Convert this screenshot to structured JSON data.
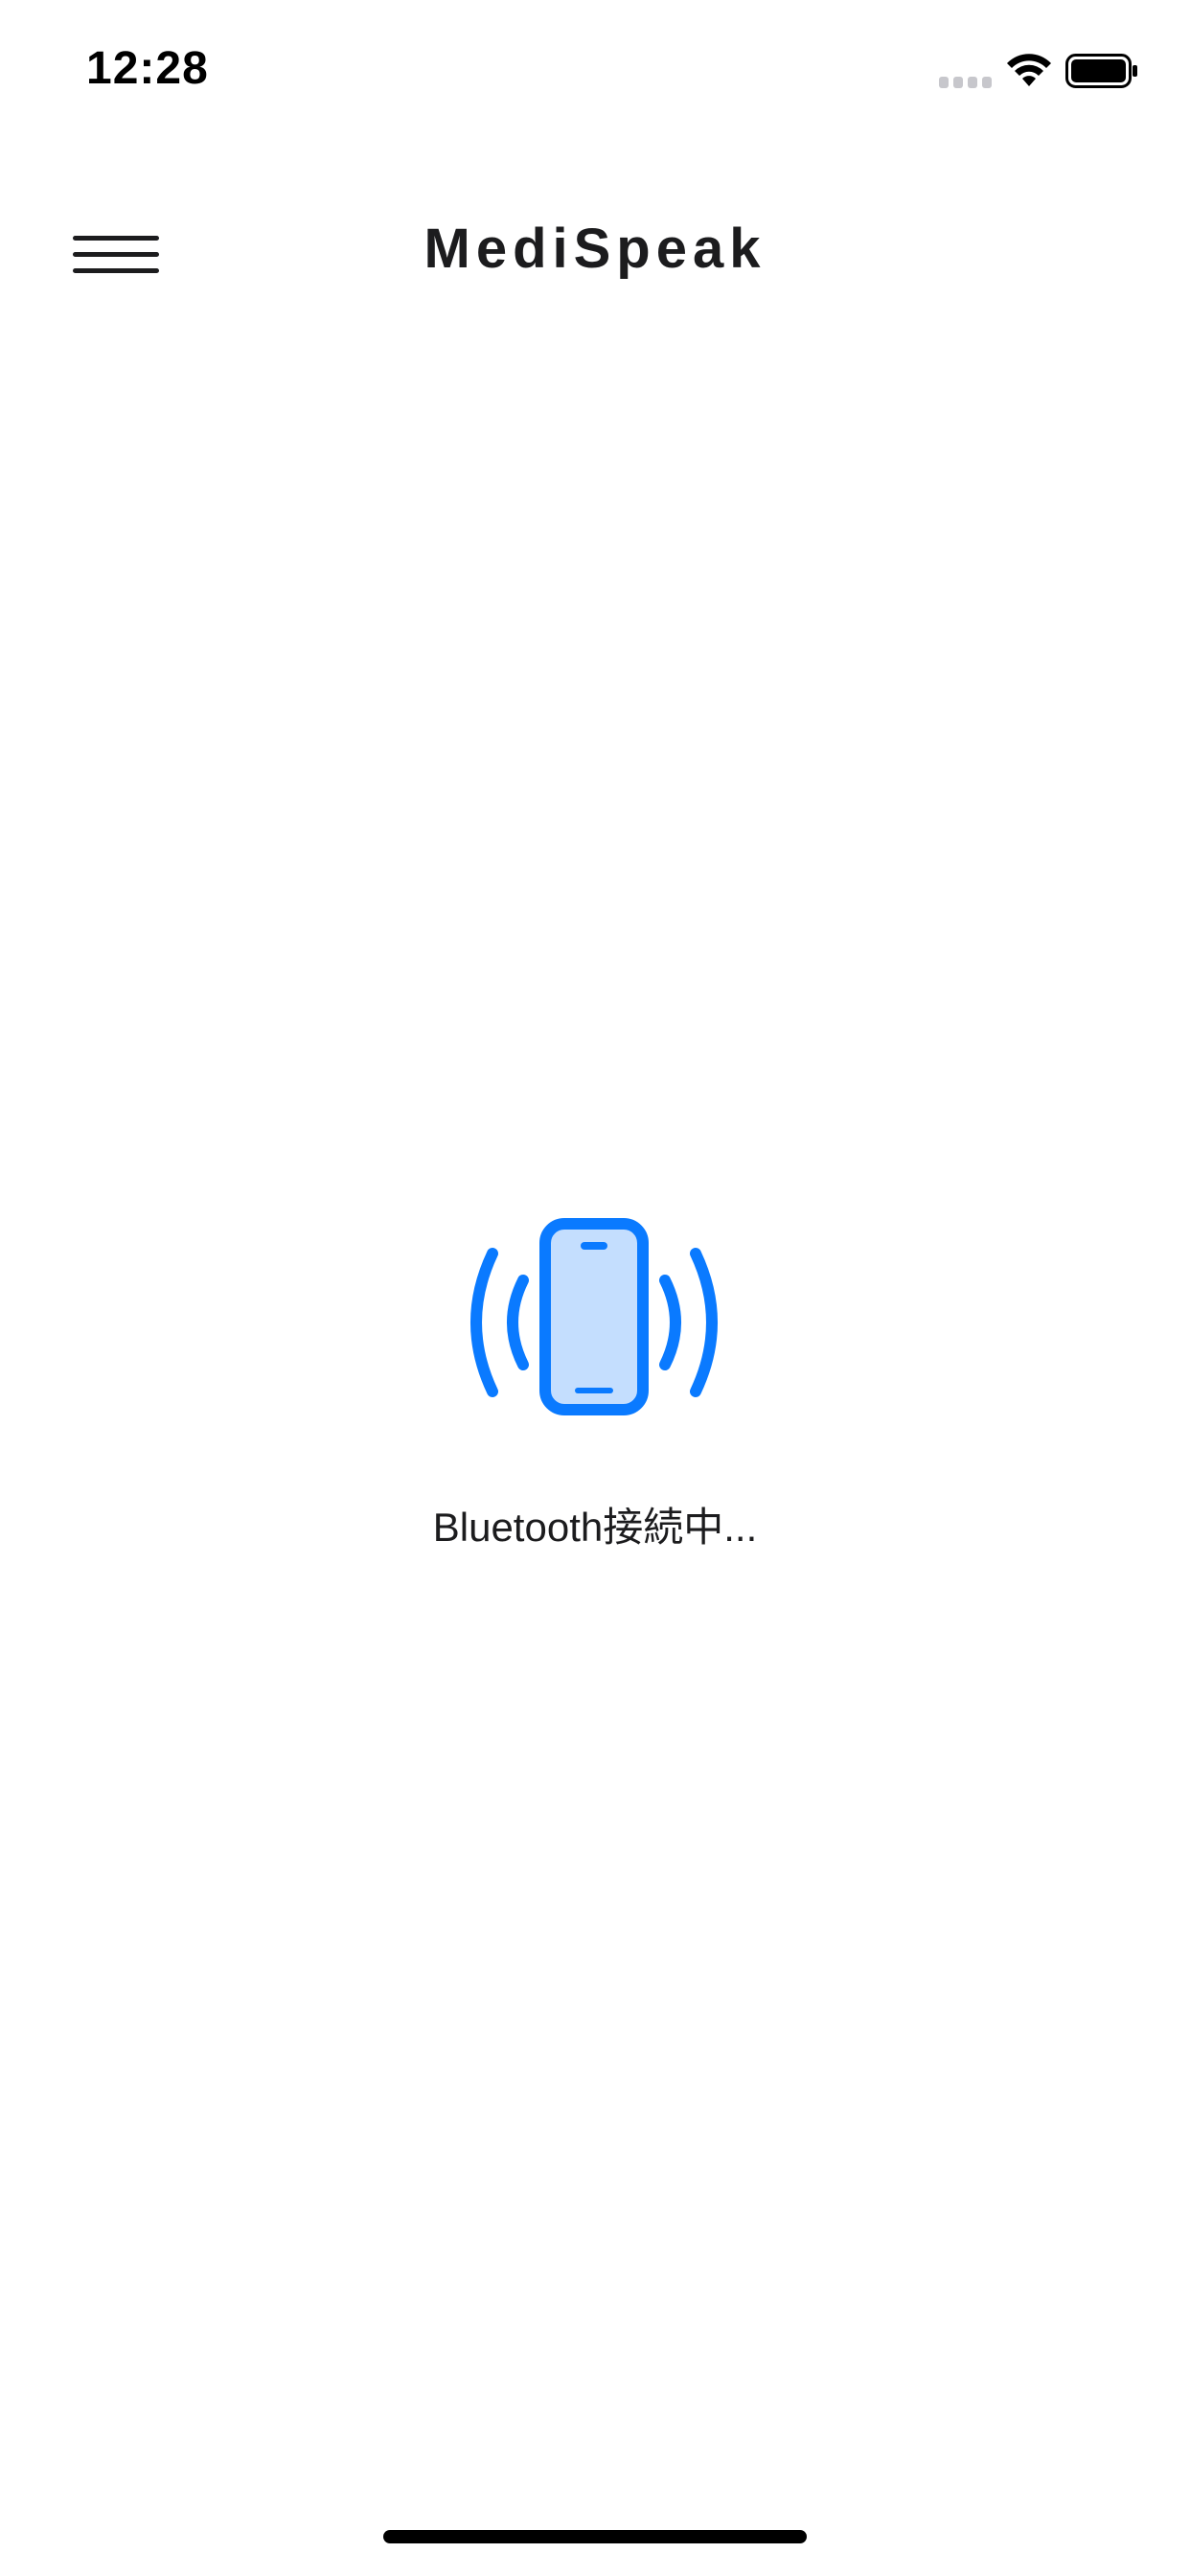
{
  "status_bar": {
    "time": "12:28",
    "icons": [
      "cellular-signal-icon",
      "wifi-icon",
      "battery-icon"
    ]
  },
  "header": {
    "title": "MediSpeak",
    "menu_icon": "hamburger-menu-icon"
  },
  "main": {
    "icon": "phone-vibrate-icon",
    "message": "Bluetooth接続中..."
  },
  "colors": {
    "accent": "#0A7AFF",
    "accent_light": "#C4DEFE",
    "text": "#1C1C1E",
    "background": "#FFFFFF"
  }
}
